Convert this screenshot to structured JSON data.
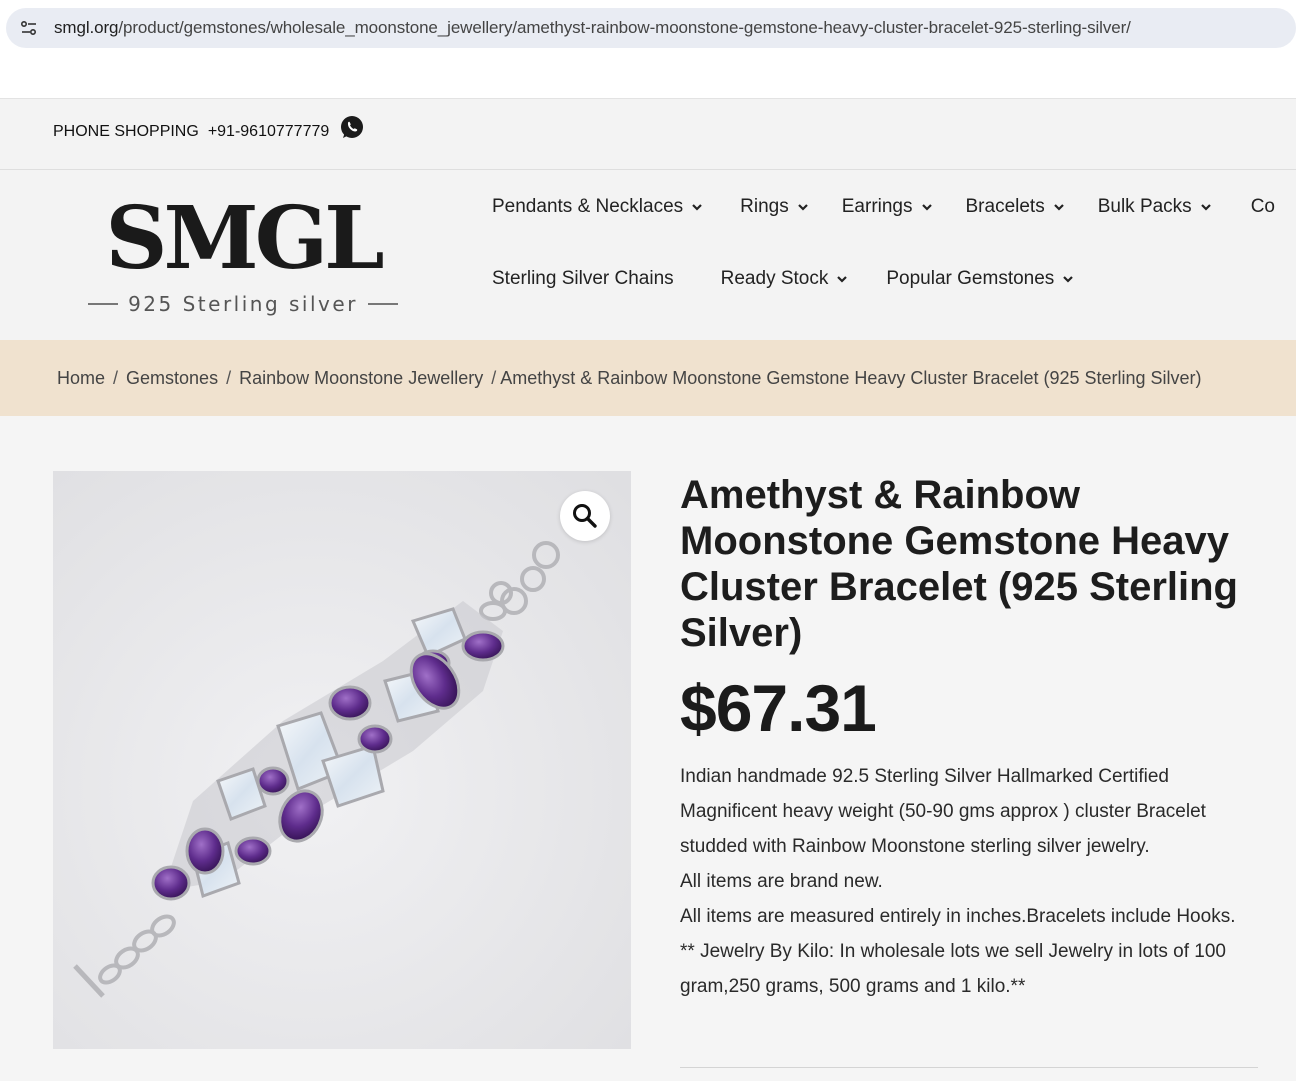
{
  "browser": {
    "url_host": "smgl.org",
    "url_path": "/product/gemstones/wholesale_moonstone_jewellery/amethyst-rainbow-moonstone-gemstone-heavy-cluster-bracelet-925-sterling-silver/"
  },
  "topbar": {
    "phone_label": "PHONE SHOPPING",
    "phone_number": "+91-9610777779"
  },
  "logo": {
    "main": "SMGL",
    "sub": "925 Sterling silver"
  },
  "nav": {
    "row1": [
      "Pendants & Necklaces",
      "Rings",
      "Earrings",
      "Bracelets",
      "Bulk Packs",
      "Co"
    ],
    "row2": [
      "Sterling Silver Chains",
      "Ready Stock",
      "Popular Gemstones"
    ]
  },
  "breadcrumb": {
    "items": [
      "Home",
      "Gemstones",
      "Rainbow Moonstone Jewellery"
    ],
    "current": "Amethyst & Rainbow Moonstone Gemstone Heavy Cluster Bracelet (925 Sterling Silver)"
  },
  "product": {
    "title": "Amethyst & Rainbow Moonstone Gemstone Heavy Cluster Bracelet (925 Sterling Silver)",
    "price": "$67.31",
    "desc": [
      "Indian handmade 92.5 Sterling Silver Hallmarked Certified Magnificent heavy weight (50-90 gms approx ) cluster Bracelet studded with Rainbow Moonstone sterling silver jewelry.",
      "All items are brand new.",
      "All items are measured entirely in inches.Bracelets include Hooks.",
      "** Jewelry By Kilo: In wholesale lots we sell Jewelry in lots of 100 gram,250 grams, 500 grams and 1 kilo.**"
    ]
  },
  "icons": {
    "site_info": "tune-icon",
    "whatsapp": "whatsapp-icon",
    "zoom": "magnifier-icon",
    "chevron": "chevron-down-icon"
  },
  "colors": {
    "breadcrumb_bg": "#f0e2cf",
    "amethyst": "#5a2a82",
    "moonstone": "#dfe6ee"
  }
}
